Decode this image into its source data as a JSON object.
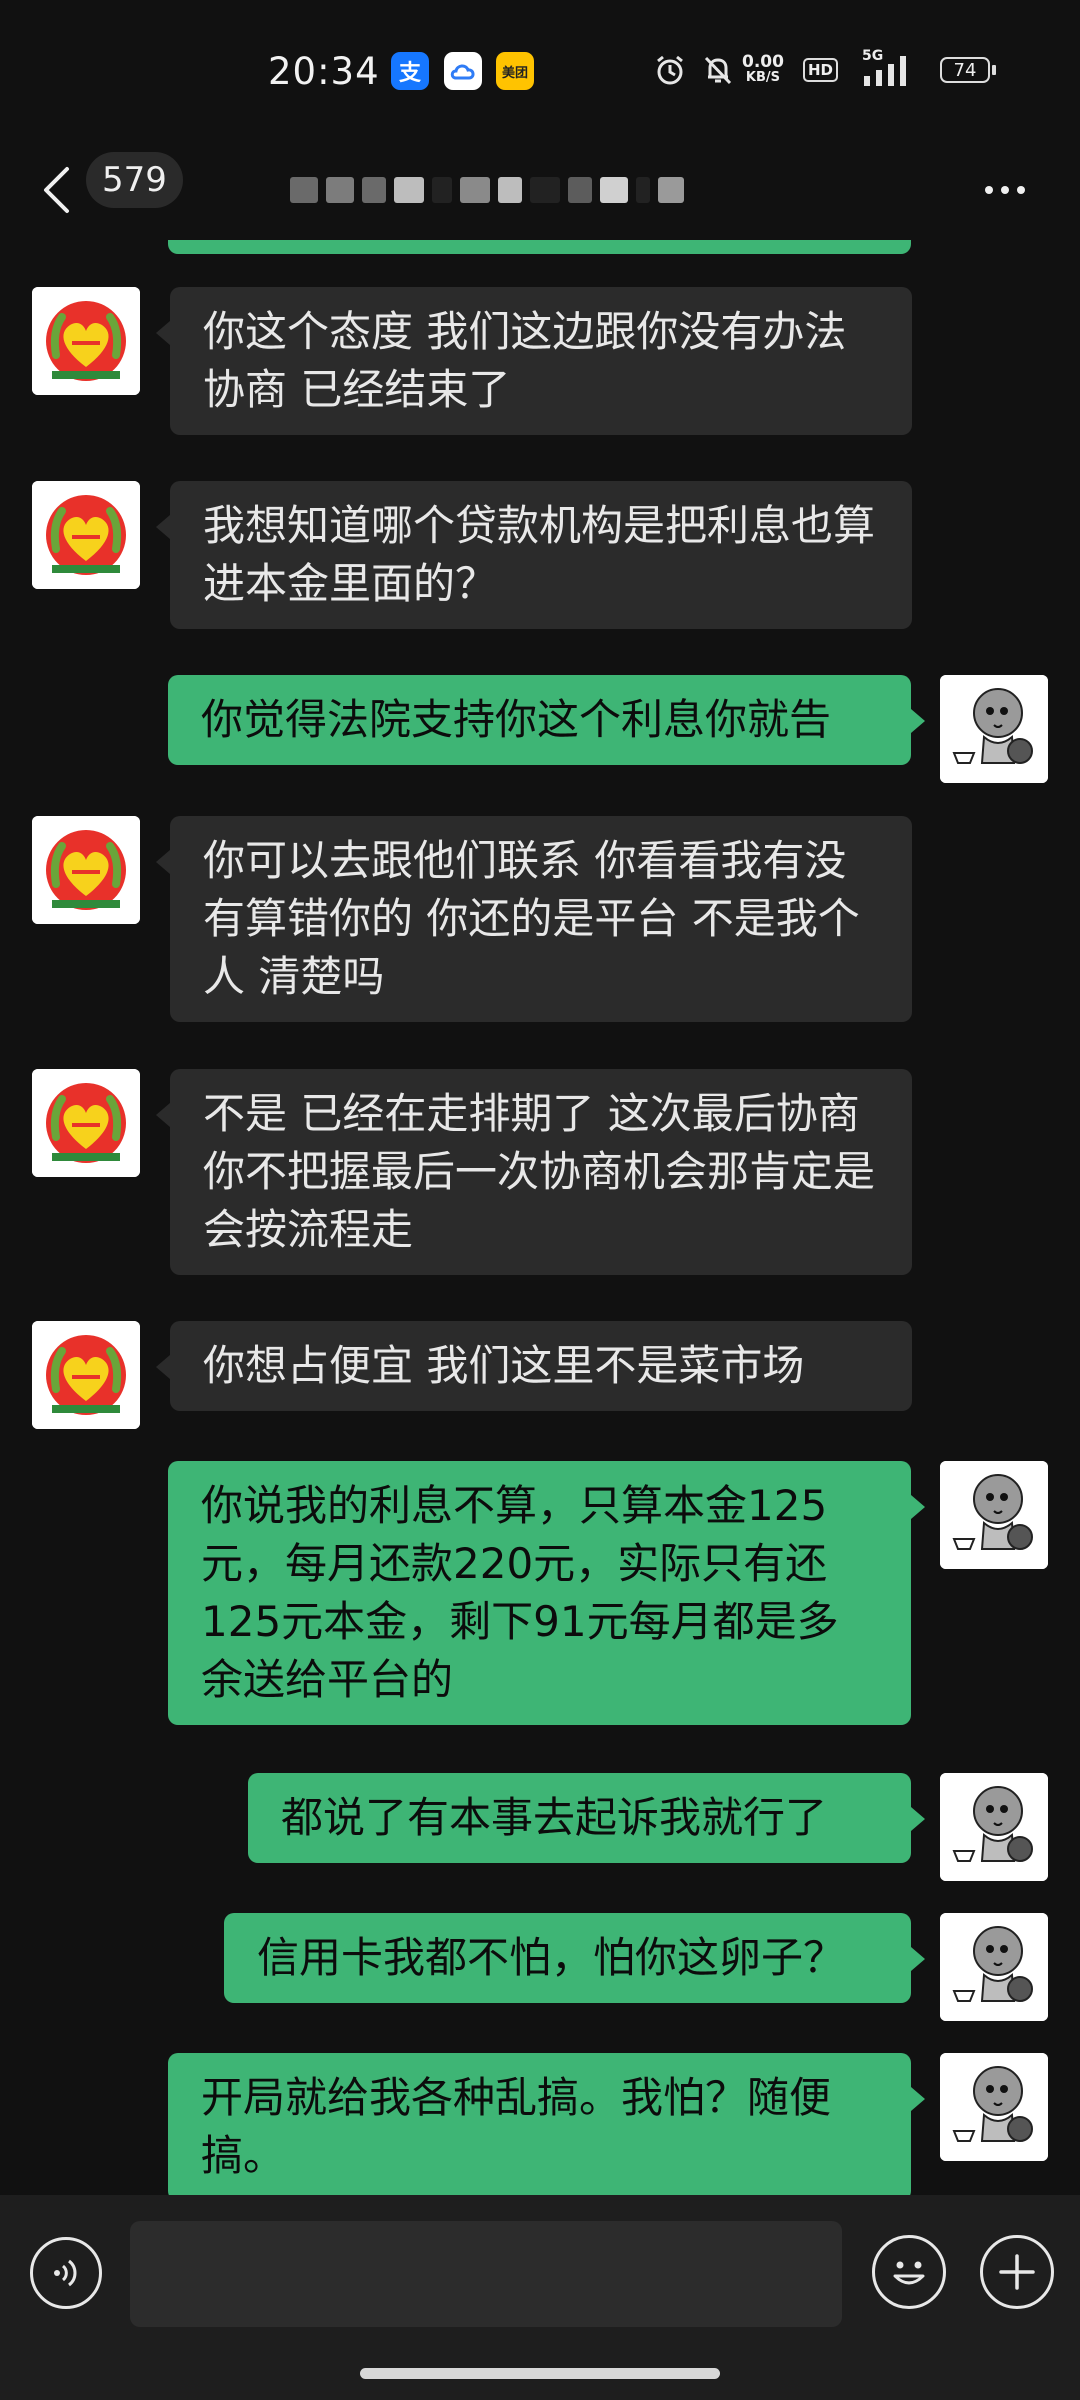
{
  "status_bar": {
    "time": "20:34",
    "app_icons": [
      "支",
      "ப",
      "美团"
    ],
    "net_speed_value": "0.00",
    "net_speed_unit": "KB/S",
    "hd_label": "HD",
    "network": "5G",
    "battery": "74"
  },
  "header": {
    "back_icon": "chevron-left-icon",
    "unread_count": "579",
    "more_icon": "more-horizontal-icon"
  },
  "messages": [
    {
      "side": "in",
      "text": "你这个态度 我们这边跟你没有办法协商 已经结束了"
    },
    {
      "side": "in",
      "text": "我想知道哪个贷款机构是把利息也算进本金里面的？"
    },
    {
      "side": "out",
      "text": "你觉得法院支持你这个利息你就告"
    },
    {
      "side": "in",
      "text": "你可以去跟他们联系 你看看我有没有算错你的 你还的是平台 不是我个人 清楚吗"
    },
    {
      "side": "in",
      "text": "不是 已经在走排期了 这次最后协商 你不把握最后一次协商机会那肯定是会按流程走"
    },
    {
      "side": "in",
      "text": "你想占便宜 我们这里不是菜市场"
    },
    {
      "side": "out",
      "text": "你说我的利息不算，只算本金125元，每月还款220元，实际只有还125元本金，剩下91元每月都是多余送给平台的"
    },
    {
      "side": "out",
      "text": "都说了有本事去起诉我就行了"
    },
    {
      "side": "out",
      "text": "信用卡我都不怕，怕你这卵子？"
    },
    {
      "side": "out",
      "text": "开局就给我各种乱搞。我怕？随便搞。"
    }
  ],
  "input_bar": {
    "voice_icon": "voice-icon",
    "input_value": "",
    "emoji_icon": "emoji-icon",
    "plus_icon": "plus-icon"
  },
  "colors": {
    "background": "#111111",
    "outgoing_bubble": "#3eb575",
    "incoming_bubble": "#2b2b2b"
  }
}
